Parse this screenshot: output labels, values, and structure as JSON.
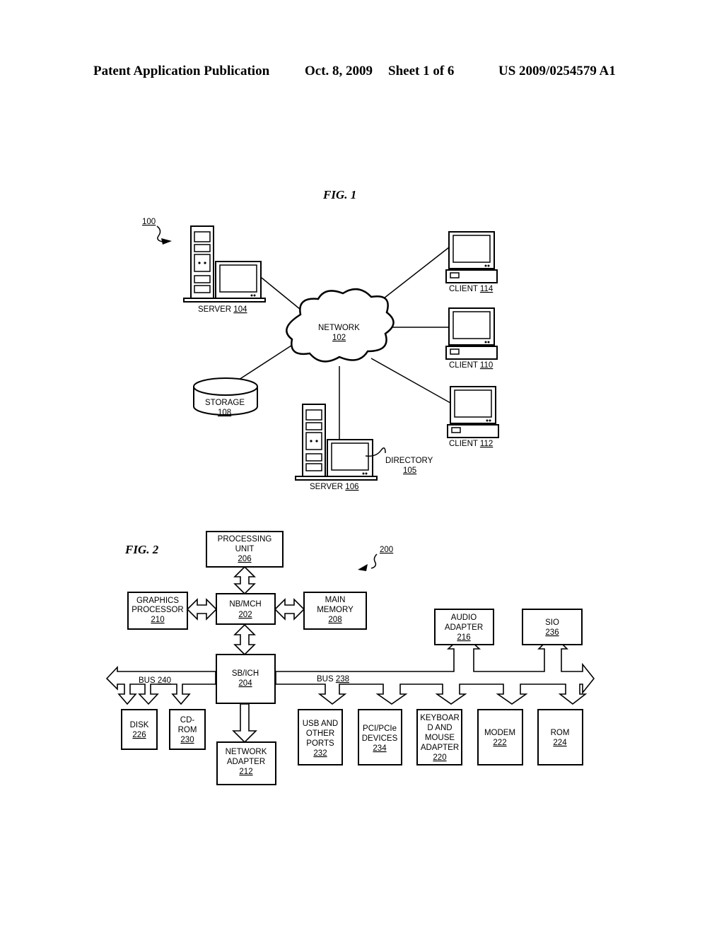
{
  "header": {
    "publication": "Patent Application Publication",
    "date": "Oct. 8, 2009",
    "sheet": "Sheet 1 of 6",
    "number": "US 2009/0254579 A1"
  },
  "fig1": {
    "title": "FIG. 1",
    "ref": "100",
    "network": {
      "label": "NETWORK",
      "num": "102"
    },
    "server104": {
      "label": "SERVER",
      "num": "104"
    },
    "server106": {
      "label": "SERVER",
      "num": "106"
    },
    "directory": {
      "label": "DIRECTORY",
      "num": "105"
    },
    "storage": {
      "label": "STORAGE",
      "num": "108"
    },
    "client114": {
      "label": "CLIENT",
      "num": "114"
    },
    "client110": {
      "label": "CLIENT",
      "num": "110"
    },
    "client112": {
      "label": "CLIENT",
      "num": "112"
    }
  },
  "fig2": {
    "title": "FIG. 2",
    "ref": "200",
    "processing_unit": {
      "l1": "PROCESSING",
      "l2": "UNIT",
      "num": "206"
    },
    "nb_mch": {
      "l1": "NB/MCH",
      "num": "202"
    },
    "graphics": {
      "l1": "GRAPHICS",
      "l2": "PROCESSOR",
      "num": "210"
    },
    "main_memory": {
      "l1": "MAIN",
      "l2": "MEMORY",
      "num": "208"
    },
    "sb_ich": {
      "l1": "SB/ICH",
      "num": "204"
    },
    "bus240": {
      "label": "BUS",
      "num": "240"
    },
    "bus238": {
      "label": "BUS",
      "num": "238"
    },
    "disk": {
      "l1": "DISK",
      "num": "226"
    },
    "cdrom": {
      "l1": "CD-",
      "l2": "ROM",
      "num": "230"
    },
    "network_adapter": {
      "l1": "NETWORK",
      "l2": "ADAPTER",
      "num": "212"
    },
    "usb": {
      "l1": "USB AND",
      "l2": "OTHER",
      "l3": "PORTS",
      "num": "232"
    },
    "pci": {
      "l1": "PCI/PCIe",
      "l2": "DEVICES",
      "num": "234"
    },
    "keyboard": {
      "l1": "KEYBOAR",
      "l2": "D AND",
      "l3": "MOUSE",
      "l4": "ADAPTER",
      "num": "220"
    },
    "modem": {
      "l1": "MODEM",
      "num": "222"
    },
    "rom": {
      "l1": "ROM",
      "num": "224"
    },
    "audio": {
      "l1": "AUDIO",
      "l2": "ADAPTER",
      "num": "216"
    },
    "sio": {
      "l1": "SIO",
      "num": "236"
    }
  }
}
